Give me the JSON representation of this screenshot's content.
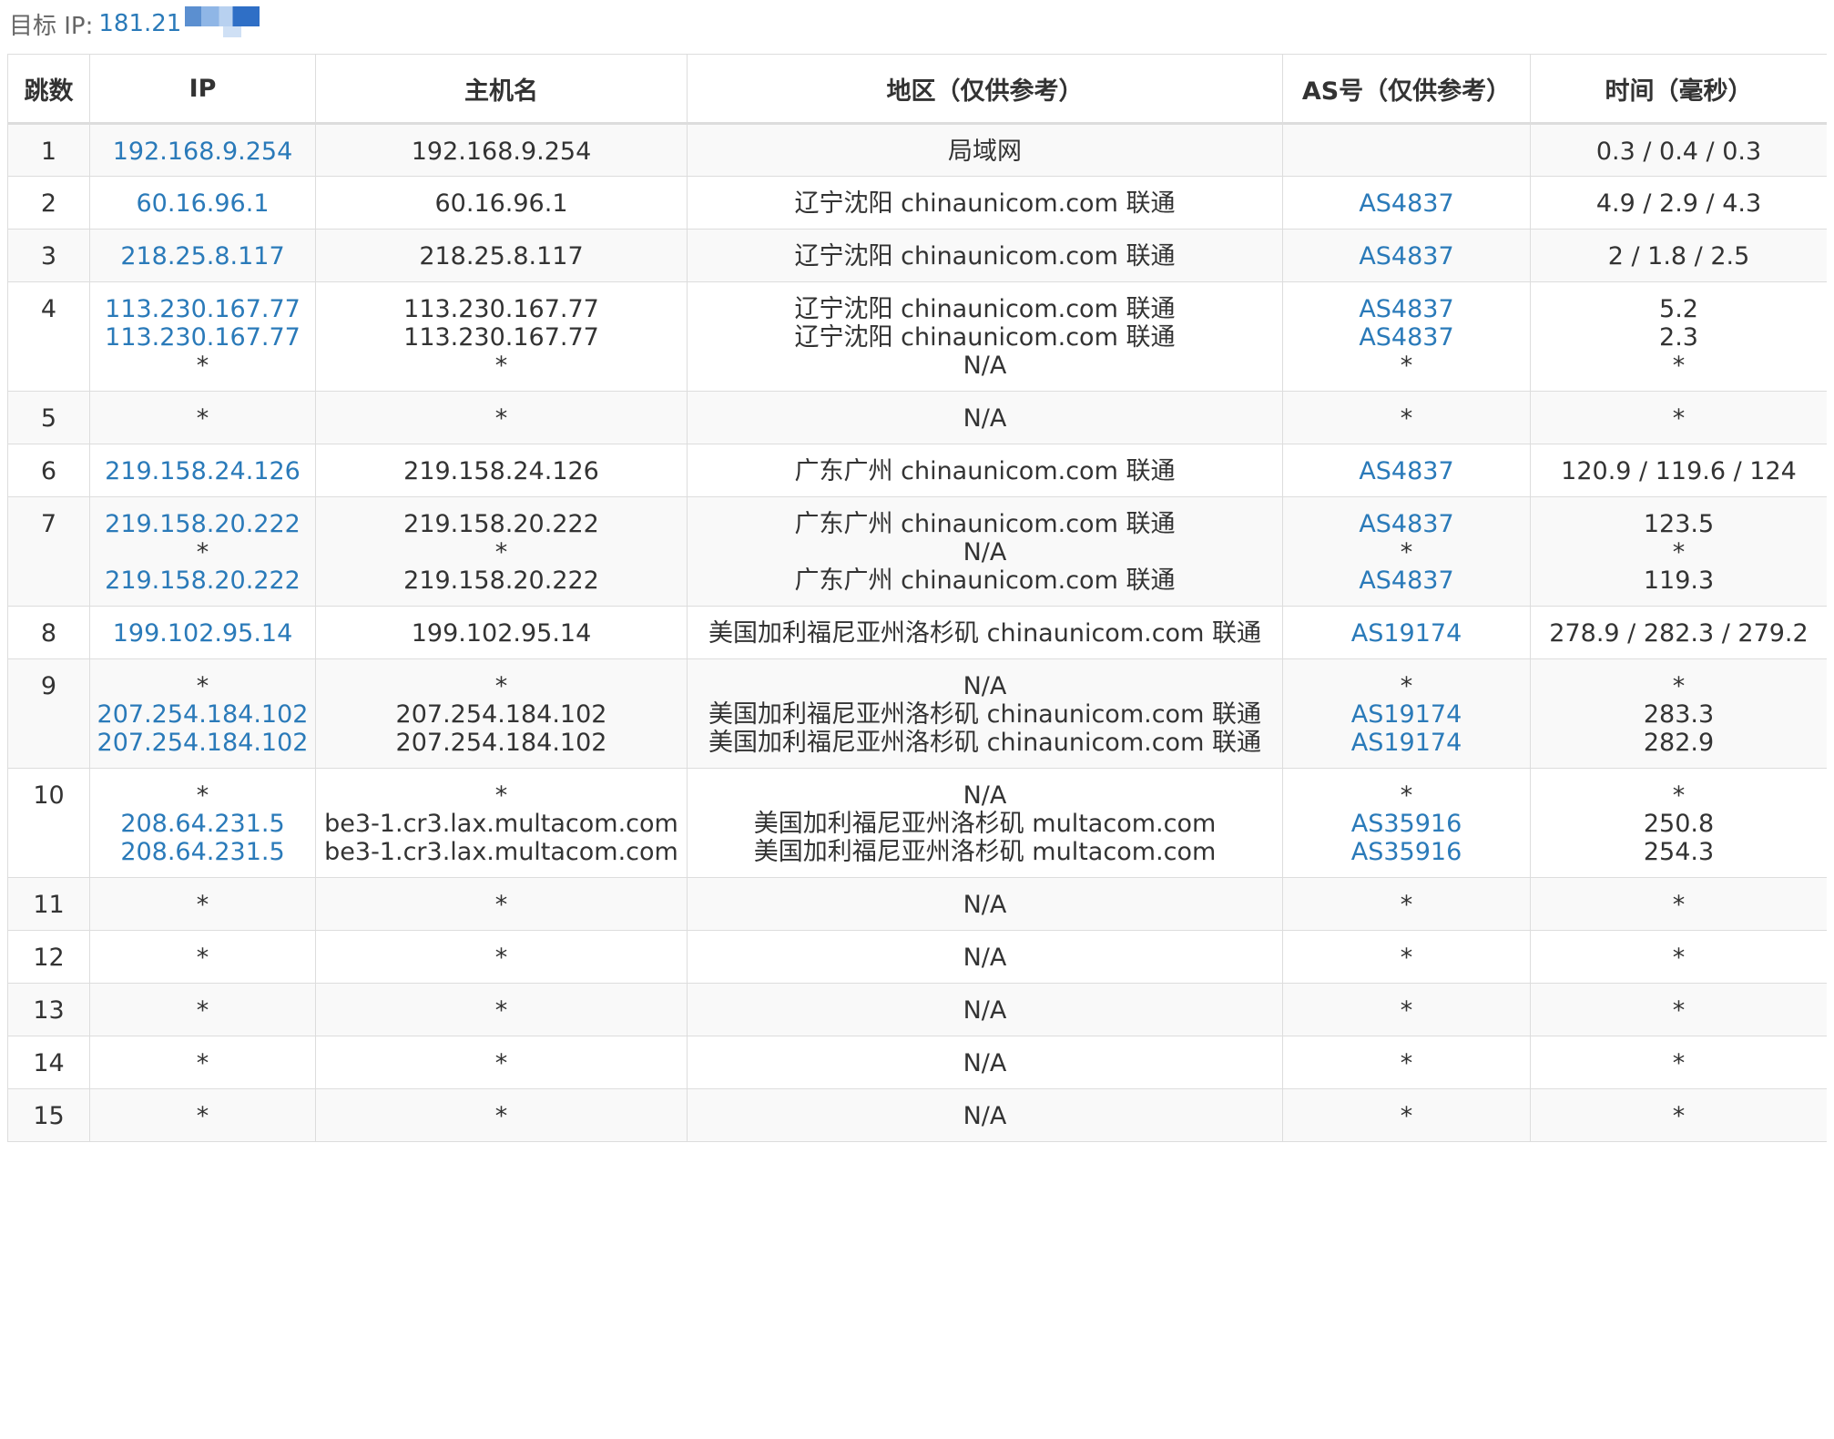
{
  "target": {
    "label": "目标 IP:",
    "ip_partial": "181.21"
  },
  "colors": {
    "link": "#2a7ab9",
    "border": "#dddddd",
    "stripe": "#f9f9f9",
    "text": "#333333"
  },
  "table": {
    "columns": [
      "跳数",
      "IP",
      "主机名",
      "地区（仅供参考）",
      "AS号（仅供参考）",
      "时间（毫秒）"
    ],
    "rows": [
      {
        "hop": "1",
        "ips": [
          "192.168.9.254"
        ],
        "hosts": [
          "192.168.9.254"
        ],
        "regions": [
          "局域网"
        ],
        "as": [
          ""
        ],
        "times": [
          "0.3 / 0.4 / 0.3"
        ]
      },
      {
        "hop": "2",
        "ips": [
          "60.16.96.1"
        ],
        "hosts": [
          "60.16.96.1"
        ],
        "regions": [
          "辽宁沈阳 chinaunicom.com 联通"
        ],
        "as": [
          "AS4837"
        ],
        "times": [
          "4.9 / 2.9 / 4.3"
        ]
      },
      {
        "hop": "3",
        "ips": [
          "218.25.8.117"
        ],
        "hosts": [
          "218.25.8.117"
        ],
        "regions": [
          "辽宁沈阳 chinaunicom.com 联通"
        ],
        "as": [
          "AS4837"
        ],
        "times": [
          "2 / 1.8 / 2.5"
        ]
      },
      {
        "hop": "4",
        "ips": [
          "113.230.167.77",
          "113.230.167.77",
          "*"
        ],
        "hosts": [
          "113.230.167.77",
          "113.230.167.77",
          "*"
        ],
        "regions": [
          "辽宁沈阳 chinaunicom.com 联通",
          "辽宁沈阳 chinaunicom.com 联通",
          "N/A"
        ],
        "as": [
          "AS4837",
          "AS4837",
          "*"
        ],
        "times": [
          "5.2",
          "2.3",
          "*"
        ]
      },
      {
        "hop": "5",
        "ips": [
          "*"
        ],
        "hosts": [
          "*"
        ],
        "regions": [
          "N/A"
        ],
        "as": [
          "*"
        ],
        "times": [
          "*"
        ]
      },
      {
        "hop": "6",
        "ips": [
          "219.158.24.126"
        ],
        "hosts": [
          "219.158.24.126"
        ],
        "regions": [
          "广东广州 chinaunicom.com 联通"
        ],
        "as": [
          "AS4837"
        ],
        "times": [
          "120.9 / 119.6 / 124"
        ]
      },
      {
        "hop": "7",
        "ips": [
          "219.158.20.222",
          "*",
          "219.158.20.222"
        ],
        "hosts": [
          "219.158.20.222",
          "*",
          "219.158.20.222"
        ],
        "regions": [
          "广东广州 chinaunicom.com 联通",
          "N/A",
          "广东广州 chinaunicom.com 联通"
        ],
        "as": [
          "AS4837",
          "*",
          "AS4837"
        ],
        "times": [
          "123.5",
          "*",
          "119.3"
        ]
      },
      {
        "hop": "8",
        "ips": [
          "199.102.95.14"
        ],
        "hosts": [
          "199.102.95.14"
        ],
        "regions": [
          "美国加利福尼亚州洛杉矶 chinaunicom.com 联通"
        ],
        "as": [
          "AS19174"
        ],
        "times": [
          "278.9 / 282.3 / 279.2"
        ]
      },
      {
        "hop": "9",
        "ips": [
          "*",
          "207.254.184.102",
          "207.254.184.102"
        ],
        "hosts": [
          "*",
          "207.254.184.102",
          "207.254.184.102"
        ],
        "regions": [
          "N/A",
          "美国加利福尼亚州洛杉矶 chinaunicom.com 联通",
          "美国加利福尼亚州洛杉矶 chinaunicom.com 联通"
        ],
        "as": [
          "*",
          "AS19174",
          "AS19174"
        ],
        "times": [
          "*",
          "283.3",
          "282.9"
        ]
      },
      {
        "hop": "10",
        "ips": [
          "*",
          "208.64.231.5",
          "208.64.231.5"
        ],
        "hosts": [
          "*",
          "be3-1.cr3.lax.multacom.com",
          "be3-1.cr3.lax.multacom.com"
        ],
        "regions": [
          "N/A",
          "美国加利福尼亚州洛杉矶 multacom.com",
          "美国加利福尼亚州洛杉矶 multacom.com"
        ],
        "as": [
          "*",
          "AS35916",
          "AS35916"
        ],
        "times": [
          "*",
          "250.8",
          "254.3"
        ]
      },
      {
        "hop": "11",
        "ips": [
          "*"
        ],
        "hosts": [
          "*"
        ],
        "regions": [
          "N/A"
        ],
        "as": [
          "*"
        ],
        "times": [
          "*"
        ]
      },
      {
        "hop": "12",
        "ips": [
          "*"
        ],
        "hosts": [
          "*"
        ],
        "regions": [
          "N/A"
        ],
        "as": [
          "*"
        ],
        "times": [
          "*"
        ]
      },
      {
        "hop": "13",
        "ips": [
          "*"
        ],
        "hosts": [
          "*"
        ],
        "regions": [
          "N/A"
        ],
        "as": [
          "*"
        ],
        "times": [
          "*"
        ]
      },
      {
        "hop": "14",
        "ips": [
          "*"
        ],
        "hosts": [
          "*"
        ],
        "regions": [
          "N/A"
        ],
        "as": [
          "*"
        ],
        "times": [
          "*"
        ]
      },
      {
        "hop": "15",
        "ips": [
          "*"
        ],
        "hosts": [
          "*"
        ],
        "regions": [
          "N/A"
        ],
        "as": [
          "*"
        ],
        "times": [
          "*"
        ]
      }
    ]
  }
}
